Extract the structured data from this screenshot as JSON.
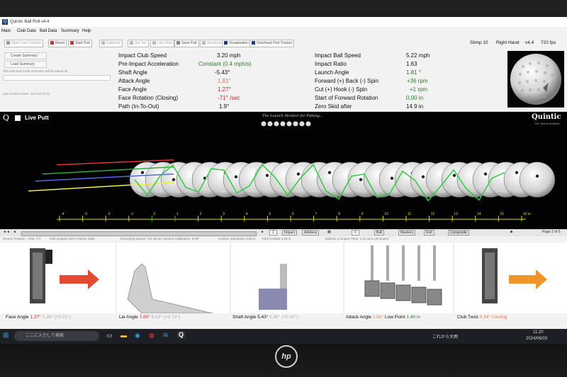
{
  "window": {
    "title": "Quintic Ball Roll v4.4"
  },
  "menu": [
    "Main",
    "Club Data",
    "Ball Data",
    "Summary",
    "Help"
  ],
  "toolbar": {
    "buttons": [
      "Open Live Camera",
      "Reset",
      "Start Putt",
      "Calibrate",
      "Set Tee",
      "Live Shot",
      "Save Putt",
      "Sessions",
      "Visualisation",
      "Overhead Putt Tracker"
    ],
    "stimp": "Stimp 10",
    "hand": "Right Hand",
    "version": "v4.4",
    "fps": "720 fps"
  },
  "left_panel": {
    "create_summary": "Create Summary",
    "load_summary": "Load Summary",
    "note": "The next putt in the summary will be saved as :",
    "lie_angle_note": "Live Access Level : 6.8 mm (0 in)"
  },
  "club_metrics": [
    {
      "label": "Impact Club Speed",
      "value": "3.20 mph",
      "color": "#111111"
    },
    {
      "label": "Pre-Impact Acceleration",
      "value": "Constant (0.4 mph/s)",
      "color": "#2a7a2a"
    },
    {
      "label": "Shaft Angle",
      "value": "-5.43°",
      "color": "#111111"
    },
    {
      "label": "Attack Angle",
      "value": "1.81°",
      "color": "#e07a50"
    },
    {
      "label": "Face Angle",
      "value": "1.27°",
      "color": "#cc2222"
    },
    {
      "label": "Face Rotation (Closing)",
      "value": "-71° /sec",
      "color": "#cc2222"
    },
    {
      "label": "Path (In-To-Out)",
      "value": "1.9°",
      "color": "#111111"
    }
  ],
  "ball_metrics": [
    {
      "label": "Impact Ball Speed",
      "value": "5.22 mph",
      "color": "#111111"
    },
    {
      "label": "Impact Ratio",
      "value": "1.63",
      "color": "#111111"
    },
    {
      "label": "Launch Angle",
      "value": "1.81 °",
      "color": "#2a7a2a"
    },
    {
      "label": "Forward (+) Back (-) Spin",
      "value": "+36 rpm",
      "color": "#2a7a2a"
    },
    {
      "label": "Cut (+) Hook (-) Spin",
      "value": "+1 rpm",
      "color": "#2a7a2a"
    },
    {
      "label": "Start of Forward Rotation",
      "value": "0.00 in",
      "color": "#2a7a2a"
    },
    {
      "label": "Zero Skid after",
      "value": "14.9 in",
      "color": "#111111"
    }
  ],
  "live": {
    "title": "Live Putt",
    "tagline": "The Launch Monitor for Putting...",
    "brand": "Quintic",
    "brand_sub": "The Sports Analysis"
  },
  "ruler": {
    "labels": [
      "-4",
      "-3",
      "-2",
      "-1",
      "0",
      "1",
      "2",
      "3",
      "4",
      "5",
      "6",
      "7",
      "8",
      "9",
      "10",
      "11",
      "12",
      "13",
      "14",
      "15",
      "16 in"
    ]
  },
  "controls": {
    "frame": "1",
    "buttons": [
      "Impact",
      "Address",
      "Ball",
      "Markers",
      "Roll",
      "Composite"
    ],
    "step": "0",
    "page": "Page 2 of 5"
  },
  "info": {
    "screen_position": "Screen Position : (750, 17)",
    "putt_analysis": "Putt Analysis 99% Frames valid",
    "recording_speed": "Recording Speed: 721.25 fps  Camera Calibration: 0.08\"",
    "surface": "Surface Interaction 0.50 in",
    "first_contact": "First Contact 3.03 in",
    "address_time": "Address to Impact Time: 1.32 secs (40.6cpm)"
  },
  "views": [
    {
      "label": "Face Angle",
      "value": "1.27°",
      "v2": "1.26°",
      "v3": "(+0.01°)",
      "color": "#cc2222"
    },
    {
      "label": "Lie Angle",
      "value": "7.80°",
      "v2": "8.53°",
      "v3": "(+0.73°)",
      "color": "#cc2222"
    },
    {
      "label": "Shaft Angle",
      "value": "5.43°",
      "v2": "5.85°",
      "v3": "(+0.42°)",
      "color": "#111111"
    },
    {
      "label": "Attack Angle",
      "value": "1.81°",
      "v2": "Low Point",
      "v3": "1.40 in",
      "color": "#e07a50"
    },
    {
      "label": "Club Twist",
      "value": "0.34° Closing",
      "v2": "",
      "v3": "",
      "color": "#e07a50"
    }
  ],
  "taskbar": {
    "search_placeholder": "ここに入力して検索",
    "weather": "これから大雨",
    "time": "11:20",
    "date": "2024/06/03"
  },
  "monitor_logo": "hp"
}
